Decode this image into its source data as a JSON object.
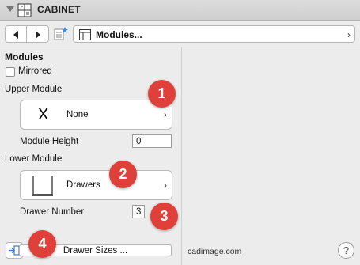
{
  "header": {
    "title": "CABINET",
    "icon": "cabinet-icon",
    "collapse_icon": "triangle-down-icon"
  },
  "toolbar": {
    "prev_icon": "arrow-left-icon",
    "next_icon": "arrow-right-icon",
    "favorites_icon": "favorites-icon",
    "module_select": "Modules...",
    "module_select_icon": "panel-layout-icon"
  },
  "section": {
    "title": "Modules",
    "mirrored": {
      "label": "Mirrored",
      "checked": false
    },
    "upper": {
      "label": "Upper Module",
      "value": "None",
      "glyph": "X",
      "height_label": "Module Height",
      "height_value": "0"
    },
    "lower": {
      "label": "Lower Module",
      "value": "Drawers",
      "number_label": "Drawer Number",
      "number_value": "3"
    },
    "drawer_sizes": "Drawer Sizes ..."
  },
  "footer": {
    "brand": "cadimage.com",
    "help": "?"
  },
  "badges": [
    "1",
    "2",
    "3",
    "4"
  ],
  "colors": {
    "badge": "#e0403a",
    "background": "#ececec"
  }
}
